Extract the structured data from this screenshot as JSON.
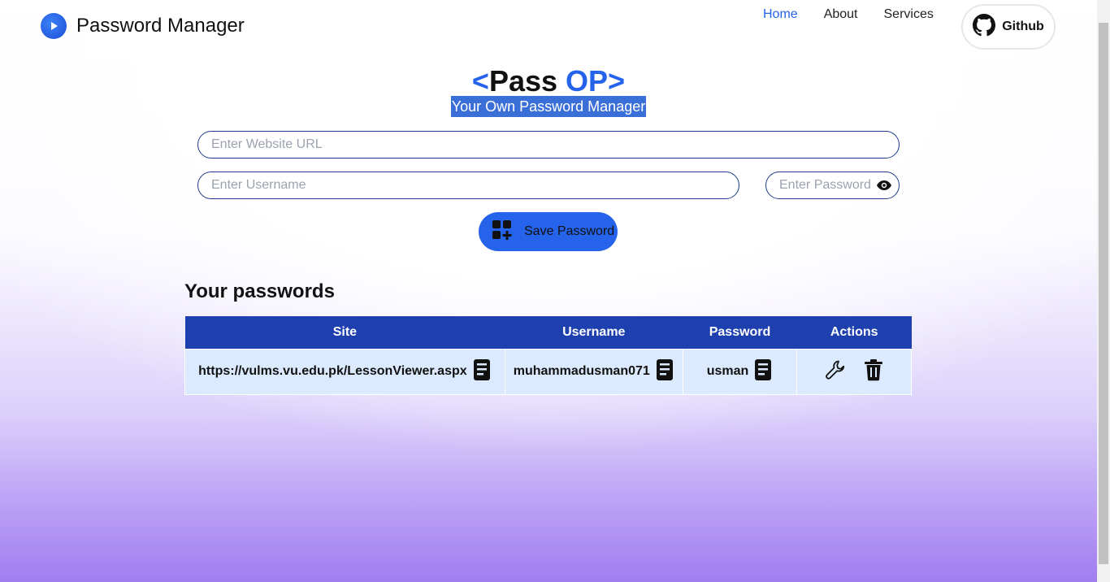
{
  "nav": {
    "app_title": "Password Manager",
    "links": [
      {
        "label": "Home",
        "active": true
      },
      {
        "label": "About",
        "active": false
      },
      {
        "label": "Services",
        "active": false
      }
    ],
    "github_label": "Github"
  },
  "hero": {
    "lt": "<",
    "pass": "Pass",
    "op": "OP",
    "gt": ">",
    "tagline": "Your Own Password Manager"
  },
  "form": {
    "url_placeholder": "Enter Website URL",
    "username_placeholder": "Enter Username",
    "password_placeholder": "Enter Password",
    "save_label": "Save Password"
  },
  "table": {
    "title": "Your passwords",
    "headers": [
      "Site",
      "Username",
      "Password",
      "Actions"
    ],
    "rows": [
      {
        "site": "https://vulms.vu.edu.pk/LessonViewer.aspx",
        "username": "muhammadusman071",
        "password": "usman"
      }
    ]
  },
  "icons": {
    "logo": "play-circle-icon",
    "github": "github-icon",
    "eye": "eye-icon",
    "save": "add-grid-icon",
    "copy": "copy-icon",
    "edit": "wrench-icon",
    "delete": "trash-icon"
  },
  "colors": {
    "accent": "#2563eb",
    "table_header": "#1e40af",
    "row_bg": "#dbeafe"
  }
}
